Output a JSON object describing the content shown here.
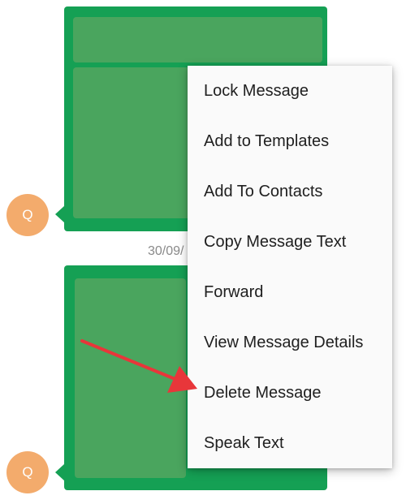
{
  "conversation": {
    "date_separator": "30/09/",
    "messages": [
      {
        "avatar_initial": "Q"
      },
      {
        "avatar_initial": "Q"
      }
    ]
  },
  "context_menu": {
    "items": [
      {
        "label": "Lock Message"
      },
      {
        "label": "Add to Templates"
      },
      {
        "label": "Add To Contacts"
      },
      {
        "label": "Copy Message Text"
      },
      {
        "label": "Forward"
      },
      {
        "label": "View Message Details"
      },
      {
        "label": "Delete Message"
      },
      {
        "label": "Speak Text"
      }
    ]
  },
  "colors": {
    "bubble": "#15a054",
    "bubble_inner": "#4aa55e",
    "avatar": "#f3ab6c",
    "menu_background": "#fafafa",
    "annotation_arrow": "#e8363a"
  },
  "icons": {
    "annotation": "red-arrow-icon"
  }
}
